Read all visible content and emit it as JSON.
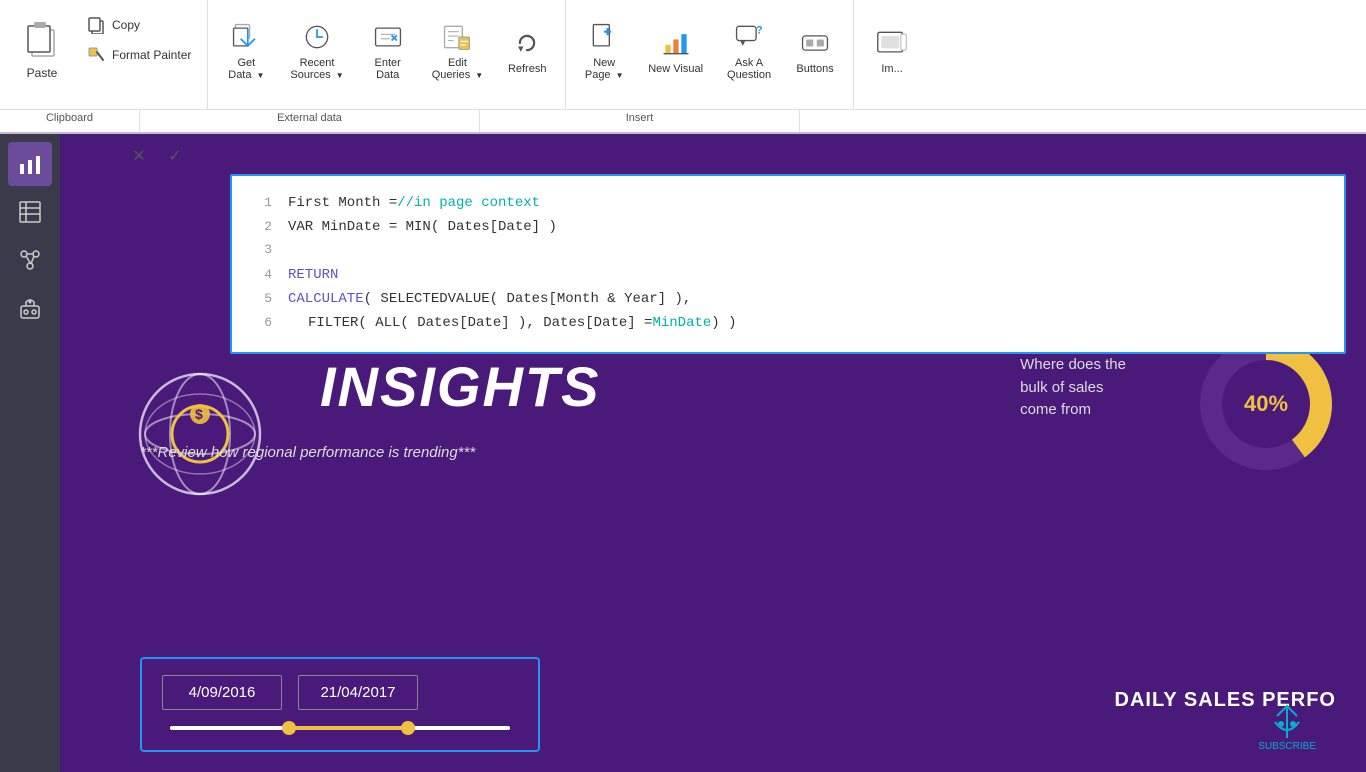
{
  "ribbon": {
    "clipboard": {
      "paste_label": "Paste",
      "copy_label": "Copy",
      "format_painter_label": "Format Painter",
      "section_label": "Clipboard"
    },
    "external_data": {
      "get_data_label": "Get\nData",
      "recent_sources_label": "Recent\nSources",
      "enter_data_label": "Enter\nData",
      "edit_queries_label": "Edit\nQueries",
      "refresh_label": "Refresh",
      "section_label": "External data"
    },
    "insert": {
      "new_page_label": "New\nPage",
      "new_visual_label": "New\nVisual",
      "ask_question_label": "Ask A\nQuestion",
      "buttons_label": "Buttons",
      "section_label": "Insert"
    }
  },
  "formula": {
    "lines": [
      {
        "num": "1",
        "parts": [
          {
            "text": "First Month = ",
            "style": "white"
          },
          {
            "text": "//in page context",
            "style": "teal"
          }
        ]
      },
      {
        "num": "2",
        "parts": [
          {
            "text": "VAR MinDate = MIN( Dates[Date] )",
            "style": "white"
          }
        ]
      },
      {
        "num": "3",
        "parts": []
      },
      {
        "num": "4",
        "parts": [
          {
            "text": "RETURN",
            "style": "blue"
          }
        ]
      },
      {
        "num": "5",
        "parts": [
          {
            "text": "CALCULATE",
            "style": "blue"
          },
          {
            "text": "( SELECTEDVALUE( Dates[Month & Year] ),",
            "style": "white"
          }
        ]
      },
      {
        "num": "6",
        "parts": [
          {
            "text": "    FILTER( ALL( Dates[Date] ), Dates[Date] = ",
            "style": "white"
          },
          {
            "text": "MinDate",
            "style": "teal"
          },
          {
            "text": " ) )",
            "style": "white"
          }
        ]
      }
    ]
  },
  "dashboard": {
    "title": "INSIGHTS",
    "subtitle": "***Review how regional performance is trending***",
    "right_text_line1": "Where does the",
    "right_text_line2": "bulk of sales",
    "right_text_line3": "come from",
    "donut_value": "40%",
    "date_start": "4/09/2016",
    "date_end": "21/04/2017",
    "daily_sales": "DAILY SALES PERFO"
  },
  "sidebar": {
    "items": [
      {
        "icon": "bar-chart",
        "label": "Report"
      },
      {
        "icon": "table",
        "label": "Data"
      },
      {
        "icon": "model",
        "label": "Model"
      },
      {
        "icon": "ai",
        "label": "AI"
      }
    ]
  }
}
